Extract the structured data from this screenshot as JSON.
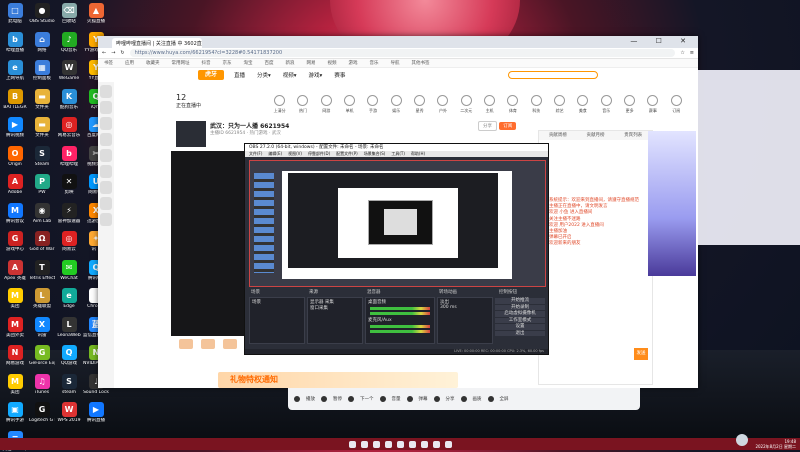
{
  "desktop": {
    "icons": [
      {
        "label": "此电脑",
        "color": "#3b7ddb",
        "g": "□"
      },
      {
        "label": "OBS Studio",
        "color": "#222",
        "g": "●"
      },
      {
        "label": "回收站",
        "color": "#8aa",
        "g": "⌫"
      },
      {
        "label": "火狐直播",
        "color": "#e63",
        "g": "▲"
      },
      {
        "label": "哔哩直播",
        "color": "#2a8fd8",
        "g": "b"
      },
      {
        "label": "网络",
        "color": "#3b7ddb",
        "g": "⌂"
      },
      {
        "label": "QQ音乐",
        "color": "#2a2",
        "g": "♪"
      },
      {
        "label": "YY游戏直播",
        "color": "#fa0",
        "g": "Y"
      },
      {
        "label": "上网导航",
        "color": "#2a8fd8",
        "g": "e"
      },
      {
        "label": "控制面板",
        "color": "#3b7ddb",
        "g": "▦"
      },
      {
        "label": "WeGame",
        "color": "#333",
        "g": "W"
      },
      {
        "label": "YY直播",
        "color": "#fb0",
        "g": "Y"
      },
      {
        "label": "BATTLEGR",
        "color": "#d90",
        "g": "B"
      },
      {
        "label": "文件夹",
        "color": "#e8b33a",
        "g": "▬"
      },
      {
        "label": "酷狗音乐",
        "color": "#2a8fd8",
        "g": "K"
      },
      {
        "label": "iQIYI",
        "color": "#2b2",
        "g": "Q"
      },
      {
        "label": "腾讯视频",
        "color": "#18f",
        "g": "▶"
      },
      {
        "label": "文件夹",
        "color": "#e8b33a",
        "g": "▬"
      },
      {
        "label": "网易云音乐",
        "color": "#d22",
        "g": "◎"
      },
      {
        "label": "百度网盘",
        "color": "#29f",
        "g": "☁"
      },
      {
        "label": "Origin",
        "color": "#f60",
        "g": "O"
      },
      {
        "label": "Steam",
        "color": "#1b2838",
        "g": "S"
      },
      {
        "label": "哔哩哔哩",
        "color": "#f26",
        "g": "b"
      },
      {
        "label": "视频剪辑",
        "color": "#444",
        "g": "✂"
      },
      {
        "label": "Adobe",
        "color": "#d22",
        "g": "A"
      },
      {
        "label": "PW",
        "color": "#2a8",
        "g": "P"
      },
      {
        "label": "剪映",
        "color": "#111",
        "g": "✕"
      },
      {
        "label": "网易UU",
        "color": "#09f",
        "g": "U"
      },
      {
        "label": "腾讯会议",
        "color": "#17f",
        "g": "M"
      },
      {
        "label": "Aim Lab",
        "color": "#333",
        "g": "◉"
      },
      {
        "label": "雷神加速器",
        "color": "#222",
        "g": "⚡"
      },
      {
        "label": "迅游加速",
        "color": "#f80",
        "g": "X"
      },
      {
        "label": "游戏中心",
        "color": "#c22",
        "g": "G"
      },
      {
        "label": "God of War",
        "color": "#822",
        "g": "Ω"
      },
      {
        "label": "网易云",
        "color": "#d22",
        "g": "◎"
      },
      {
        "label": "讯飞",
        "color": "#fa3",
        "g": "✦"
      },
      {
        "label": "Apex 英雄",
        "color": "#c33",
        "g": "A"
      },
      {
        "label": "Tetris Effect",
        "color": "#222",
        "g": "T"
      },
      {
        "label": "WeChat",
        "color": "#2c2",
        "g": "✉"
      },
      {
        "label": "腾讯QQ",
        "color": "#1af",
        "g": "Q"
      },
      {
        "label": "美团",
        "color": "#fc0",
        "g": "M"
      },
      {
        "label": "英雄联盟",
        "color": "#c93",
        "g": "L"
      },
      {
        "label": "Edge",
        "color": "#1a9",
        "g": "e"
      },
      {
        "label": "Chrome",
        "color": "#fff",
        "g": "◕"
      },
      {
        "label": "美团外卖",
        "color": "#d22",
        "g": "M"
      },
      {
        "label": "讯雷",
        "color": "#18f",
        "g": "X"
      },
      {
        "label": "LeonaWeb",
        "color": "#333",
        "g": "L"
      },
      {
        "label": "蓝信直播助手",
        "color": "#28f",
        "g": "蓝"
      },
      {
        "label": "网易游戏",
        "color": "#d22",
        "g": "N"
      },
      {
        "label": "GeForce Exp",
        "color": "#7b2",
        "g": "G"
      },
      {
        "label": "QQ游戏",
        "color": "#1af",
        "g": "Q"
      },
      {
        "label": "NVIDIA Audio",
        "color": "#7b2",
        "g": "N"
      },
      {
        "label": "美团",
        "color": "#fc0",
        "g": "M"
      },
      {
        "label": "iTunes",
        "color": "#e3a",
        "g": "♫"
      },
      {
        "label": "steam",
        "color": "#1b2838",
        "g": "S"
      },
      {
        "label": "Sound Lock",
        "color": "#333",
        "g": "♩"
      },
      {
        "label": "腾讯手游",
        "color": "#1af",
        "g": "▣"
      },
      {
        "label": "Logitech G HUB",
        "color": "#111",
        "g": "G"
      },
      {
        "label": "WPS 2019",
        "color": "#d33",
        "g": "W"
      },
      {
        "label": "腾讯直播",
        "color": "#17f",
        "g": "▶"
      },
      {
        "label": "文档2022年",
        "color": "#28f",
        "g": "≡"
      }
    ]
  },
  "browser": {
    "tab_title": "哔哩哔哩直播间 | 关注直播 中 3602直播 - 虎牙",
    "window_controls": "— ☐ ✕",
    "url": "https://www.huya.com/6621954?cl=3228#0.54171837200",
    "bookmarks": [
      "书签",
      "应用",
      "收藏夹",
      "常用网址",
      "抖音",
      "京东",
      "淘宝",
      "百度",
      "新浪",
      "网易",
      "视频",
      "游戏",
      "音乐",
      "导航",
      "其他书签"
    ],
    "nav": {
      "logo": "虎牙",
      "items": [
        "直播",
        "分类▾",
        "视频▾",
        "游戏▾",
        "赛事"
      ]
    },
    "stat": {
      "count": "12",
      "label": "正在直播中"
    },
    "categories": [
      "上清分",
      "热门",
      "网游",
      "单机",
      "手游",
      "娱乐",
      "星秀",
      "户外",
      "二次元",
      "主机",
      "体育",
      "科技",
      "综艺",
      "美食",
      "音乐",
      "更多",
      "赛事",
      "订阅"
    ],
    "room": {
      "title": "武汉：只为一人播 6621954",
      "sub": "主播ID 6621954 · 热门游戏 · 武汉",
      "avatar_label": "真我1 · 公告"
    },
    "buttons": {
      "follow": "订阅",
      "gift": "分享"
    },
    "chat": {
      "tabs": [
        "贡献周榜",
        "贡献月榜",
        "贵宾列表"
      ],
      "lines": [
        "系统提示：欢迎来到直播间，请遵守直播规范",
        "主播正在直播中，请文明发言",
        "欢迎 小鱼 进入直播间",
        "关注主播不迷路",
        "欢迎 用户2022 进入直播间",
        "主播加油",
        "弹幕已开启",
        "欢迎新来的朋友"
      ],
      "send": "发送"
    },
    "gift_banner": "礼物特权通知"
  },
  "obs": {
    "title": "OBS 27.2.0 (64-bit, windows) - 配置文件: 未命名 - 场景: 未命名",
    "menu": [
      "文件(F)",
      "编辑(E)",
      "视图(V)",
      "停靠部件(D)",
      "配置文件(P)",
      "场景集合(S)",
      "工具(T)",
      "帮助(H)"
    ],
    "panels": [
      "场景",
      "来源",
      "混音器",
      "转场动画",
      "控制按钮"
    ],
    "scene": "场景",
    "sources": [
      "显示器 采集",
      "窗口采集"
    ],
    "mixer": [
      "桌面音频",
      "麦克风/Aux"
    ],
    "transition": "淡出",
    "duration": "300 ms",
    "controls": [
      "开始推流",
      "开始录制",
      "启动虚拟摄像机",
      "工作室模式",
      "设置",
      "退出"
    ],
    "status": "LIVE: 00:00:00  REC: 00:00:00  CPU: 2.3%, 60.00 fps"
  },
  "player": {
    "items": [
      "播放",
      "暂停",
      "下一个",
      "音量",
      "弹幕",
      "分享",
      "画质",
      "全屏"
    ]
  },
  "taskbar": {
    "time": "19:48",
    "date": "2022年8月2日 星期二"
  }
}
